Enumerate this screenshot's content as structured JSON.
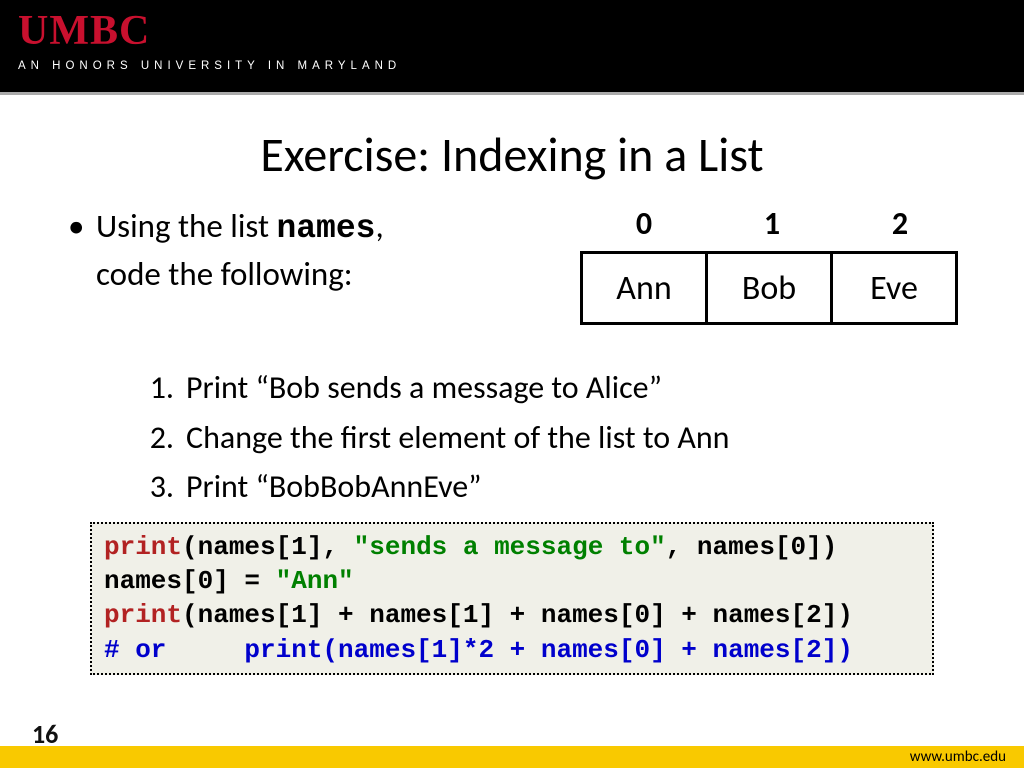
{
  "header": {
    "logo": "UMBC",
    "tagline": "AN HONORS UNIVERSITY IN MARYLAND"
  },
  "title": "Exercise: Indexing in a List",
  "bullet": {
    "line1_pre": "Using the list  ",
    "line1_mono": "names",
    "line1_post": ",",
    "line2": "code the following:"
  },
  "array": {
    "indices": [
      "0",
      "1",
      "2"
    ],
    "cells": [
      "Ann",
      "Bob",
      "Eve"
    ]
  },
  "tasks": [
    {
      "num": "1.",
      "text": "Print “Bob sends a message to Alice”"
    },
    {
      "num": "2.",
      "text": "Change the first element of the list to Ann"
    },
    {
      "num": "3.",
      "text": "Print “BobBobAnnEve”"
    }
  ],
  "code": {
    "l1": {
      "a": "print",
      "b": "(names[1], ",
      "c": "\"sends a message to\"",
      "d": ", names[0])"
    },
    "l2": {
      "a": "names[0] = ",
      "b": "\"Ann\""
    },
    "l3": {
      "a": "print",
      "b": "(names[1] + names[1] + names[0] + names[2])"
    },
    "l4": {
      "a": "# or     print(names[1]*2 + names[0] + names[2])"
    }
  },
  "footer": {
    "url": "www.umbc.edu",
    "page": "16"
  }
}
